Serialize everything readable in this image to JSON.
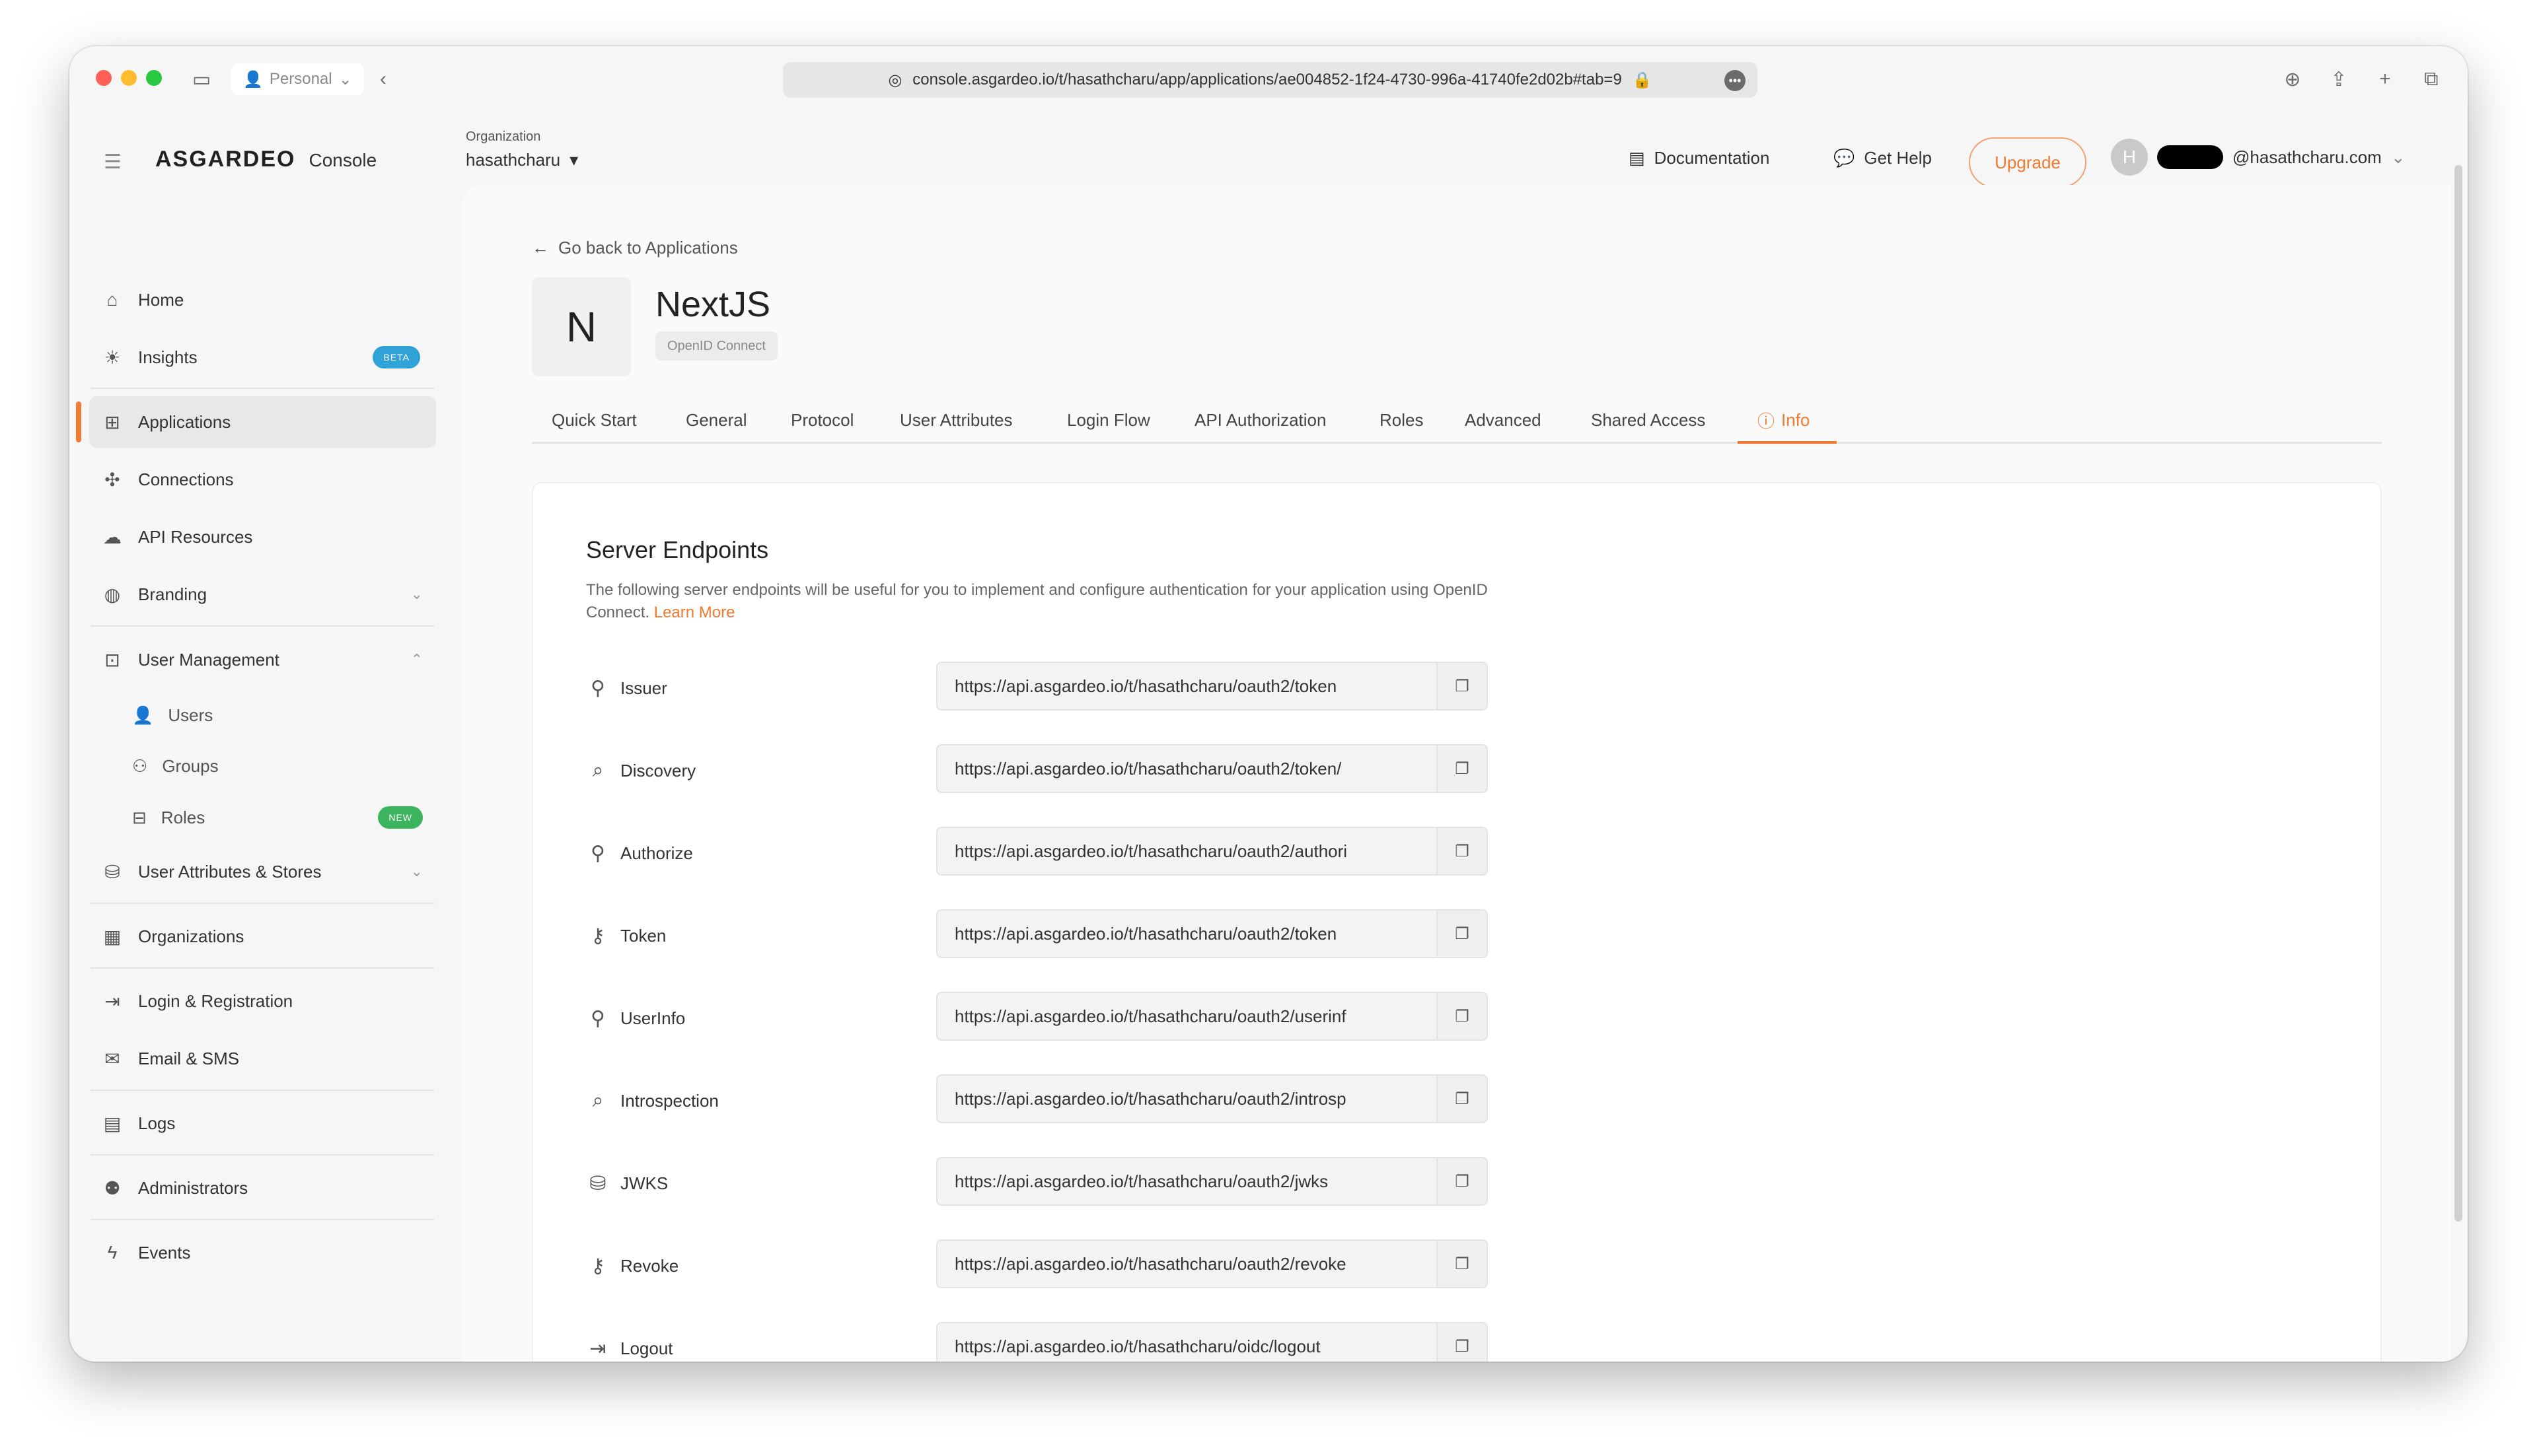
{
  "browser": {
    "profile_label": "Personal",
    "url": "console.asgardeo.io/t/hasathcharu/app/applications/ae004852-1f24-4730-996a-41740fe2d02b#tab=9"
  },
  "header": {
    "brand": "ASGARDEO",
    "console_label": "Console",
    "org_label": "Organization",
    "org_value": "hasathcharu",
    "documentation_label": "Documentation",
    "get_help_label": "Get Help",
    "upgrade_label": "Upgrade",
    "user_initial": "H",
    "user_email_suffix": "@hasathcharu.com"
  },
  "sidebar": {
    "home": "Home",
    "insights": "Insights",
    "insights_badge": "BETA",
    "applications": "Applications",
    "connections": "Connections",
    "api_resources": "API Resources",
    "branding": "Branding",
    "user_management": "User Management",
    "users": "Users",
    "groups": "Groups",
    "roles": "Roles",
    "roles_badge": "NEW",
    "user_attributes_stores": "User Attributes & Stores",
    "organizations": "Organizations",
    "login_registration": "Login & Registration",
    "email_sms": "Email & SMS",
    "logs": "Logs",
    "administrators": "Administrators",
    "events": "Events"
  },
  "main": {
    "back_label": "Go back to Applications",
    "app_initial": "N",
    "app_name": "NextJS",
    "protocol": "OpenID Connect",
    "tabs": [
      "Quick Start",
      "General",
      "Protocol",
      "User Attributes",
      "Login Flow",
      "API Authorization",
      "Roles",
      "Advanced",
      "Shared Access",
      "Info"
    ],
    "section_title": "Server Endpoints",
    "section_desc": "The following server endpoints will be useful for you to implement and configure authentication for your application using OpenID Connect.",
    "learn_more": "Learn More",
    "endpoints": [
      {
        "label": "Issuer",
        "value": "https://api.asgardeo.io/t/hasathcharu/oauth2/token"
      },
      {
        "label": "Discovery",
        "value": "https://api.asgardeo.io/t/hasathcharu/oauth2/token/"
      },
      {
        "label": "Authorize",
        "value": "https://api.asgardeo.io/t/hasathcharu/oauth2/authori"
      },
      {
        "label": "Token",
        "value": "https://api.asgardeo.io/t/hasathcharu/oauth2/token"
      },
      {
        "label": "UserInfo",
        "value": "https://api.asgardeo.io/t/hasathcharu/oauth2/userinf"
      },
      {
        "label": "Introspection",
        "value": "https://api.asgardeo.io/t/hasathcharu/oauth2/introsp"
      },
      {
        "label": "JWKS",
        "value": "https://api.asgardeo.io/t/hasathcharu/oauth2/jwks"
      },
      {
        "label": "Revoke",
        "value": "https://api.asgardeo.io/t/hasathcharu/oauth2/revoke"
      },
      {
        "label": "Logout",
        "value": "https://api.asgardeo.io/t/hasathcharu/oidc/logout"
      }
    ]
  },
  "colors": {
    "accent": "#ef7a2f",
    "beta_badge": "#2fa3d8",
    "new_badge": "#3cb35e"
  }
}
